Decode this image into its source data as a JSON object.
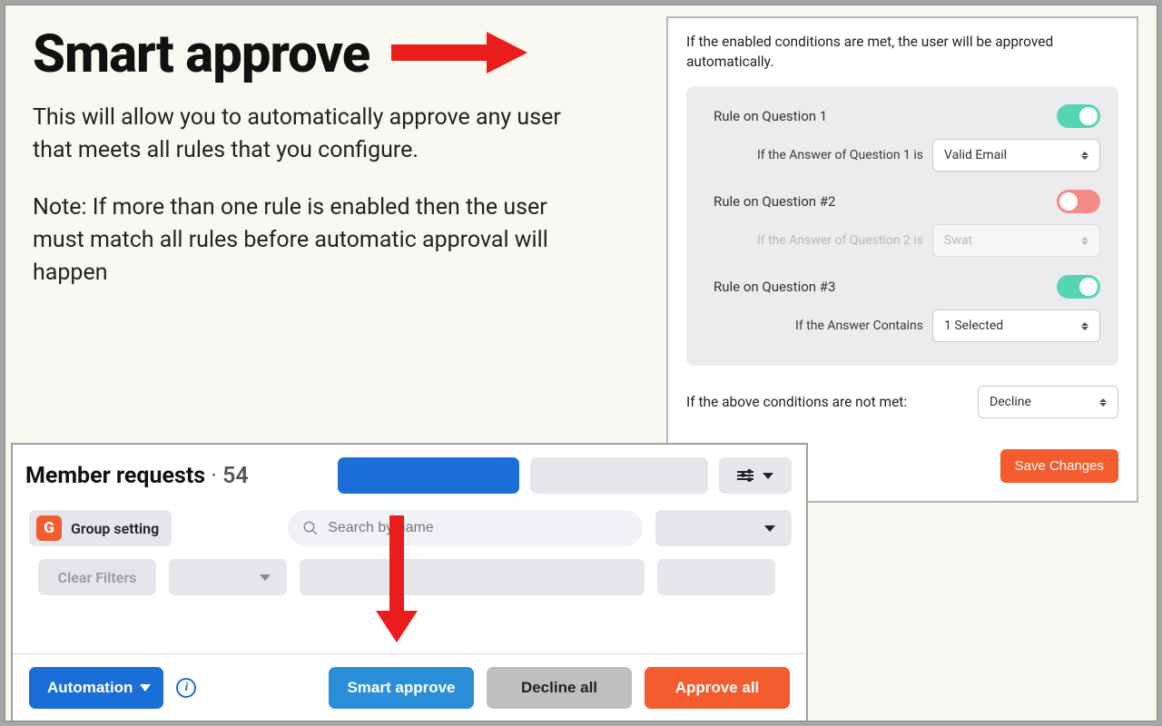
{
  "intro": {
    "title": "Smart approve",
    "para1": "This will allow you to automatically approve any user that meets all rules that you configure.",
    "para2": "Note: If more than one rule is enabled then the user must match all rules before automatic approval will happen"
  },
  "settings": {
    "description": "If the enabled conditions are met, the user will be approved automatically.",
    "rules": [
      {
        "title": "Rule on Question 1",
        "enabled": true,
        "cond_label": "If the Answer of Question 1 is",
        "select_value": "Valid Email"
      },
      {
        "title": "Rule on Question #2",
        "enabled": false,
        "cond_label": "If the Answer of Question 2 is",
        "select_value": "Swat"
      },
      {
        "title": "Rule on Question #3",
        "enabled": true,
        "cond_label": "If the Answer Contains",
        "select_value": "1 Selected"
      }
    ],
    "fallback_label": "If the above conditions are not met:",
    "fallback_value": "Decline",
    "save_label": "Save Changes"
  },
  "member_requests": {
    "title": "Member requests",
    "count": "54",
    "group_setting": "Group setting",
    "group_logo_letter": "G",
    "search_placeholder": "Search by name",
    "clear_filters": "Clear Filters",
    "automation": "Automation",
    "smart_approve": "Smart approve",
    "decline_all": "Decline all",
    "approve_all": "Approve all"
  },
  "colors": {
    "accent_red": "#ea1c1c",
    "accent_orange": "#f25c2e",
    "accent_blue": "#1a6ed8",
    "toggle_on": "#55d6b3",
    "toggle_off": "#f58b86"
  }
}
